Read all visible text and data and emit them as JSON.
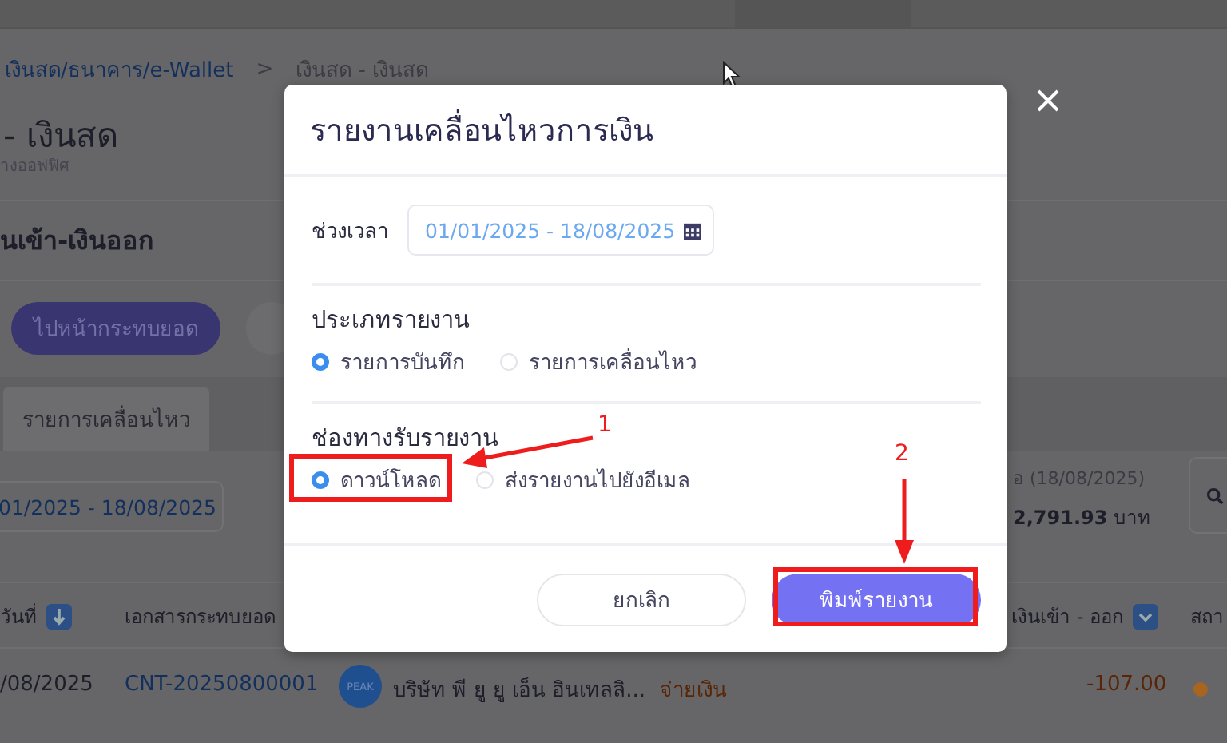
{
  "breadcrumb": [
    {
      "label": "เงินสด/ธนาคาร/e-Wallet",
      "kind": "link"
    },
    {
      "label": ">",
      "kind": "separator"
    },
    {
      "label": "เงินสด - เงินสด",
      "kind": "current"
    }
  ],
  "page": {
    "title": "- เงินสด",
    "subtitle": "างออฟฟิศ",
    "section_title": "นเข้า-เงินออก",
    "reconcile_button": "ไปหน้ากระทบยอด",
    "tabs": [
      {
        "label": "รายการเคลื่อนไหว",
        "selected": true
      }
    ],
    "date_range": "01/2025 - 18/08/2025",
    "balance_label": "อ (18/08/2025)",
    "balance_value": "2,791.93",
    "balance_unit": "บาท"
  },
  "table": {
    "columns": [
      {
        "label": "วันที่",
        "kind": "sort"
      },
      {
        "label": "เอกสารกระทบยอด",
        "kind": "plain"
      },
      {
        "label": "เงินเข้า - ออก",
        "kind": "filter"
      },
      {
        "label": "สถา",
        "kind": "plain"
      }
    ],
    "rows": [
      {
        "date": "/08/2025",
        "document": "CNT-20250800001",
        "avatar": "PEAK",
        "contact": "บริษัท พี ยู ยู เอ็น อินเทลลิ...",
        "type": "จ่ายเงิน",
        "amount": "-107.00",
        "color": "#a8651f"
      }
    ]
  },
  "modal": {
    "title": "รายงานเคลื่อนไหวการเงิน",
    "period_label": "ช่วงเวลา",
    "period_value": "01/01/2025 - 18/08/2025",
    "groups": [
      {
        "label": "ประเภทรายงาน",
        "options": [
          {
            "label": "รายการบันทึก",
            "selected": true
          },
          {
            "label": "รายการเคลื่อนไหว",
            "selected": false
          }
        ]
      },
      {
        "label": "ช่องทางรับรายงาน",
        "options": [
          {
            "label": "ดาวน์โหลด",
            "selected": true
          },
          {
            "label": "ส่งรายงานไปยังอีเมล",
            "selected": false
          }
        ]
      }
    ],
    "buttons": [
      {
        "label": "ยกเลิก",
        "kind": "secondary"
      },
      {
        "label": "พิมพ์รายงาน",
        "kind": "primary"
      }
    ]
  },
  "annotations": [
    {
      "label": "1"
    },
    {
      "label": "2"
    }
  ]
}
